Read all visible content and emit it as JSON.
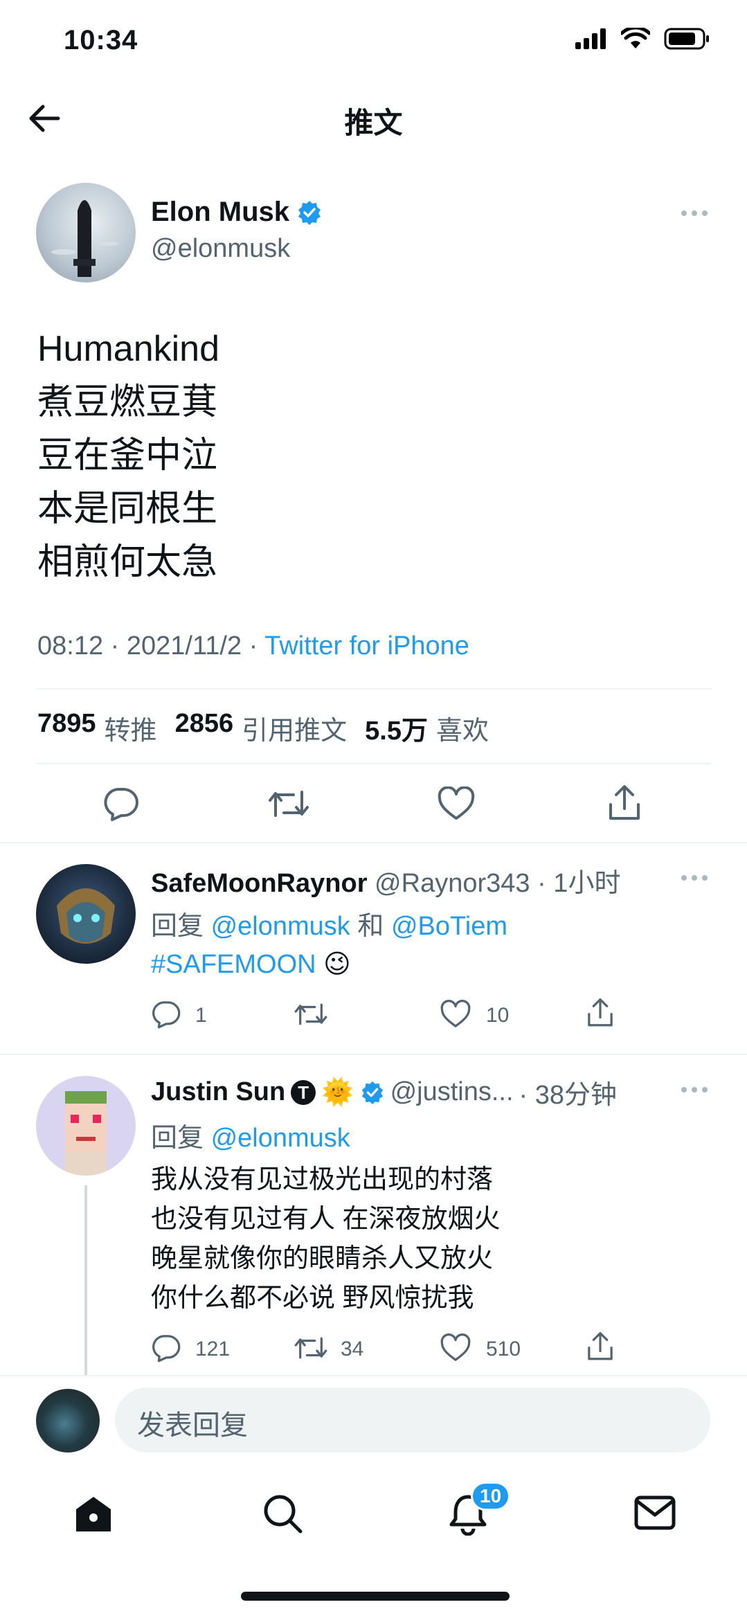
{
  "status_bar": {
    "time": "10:34"
  },
  "header": {
    "title": "推文"
  },
  "tweet": {
    "author_name": "Elon Musk",
    "author_handle": "@elonmusk",
    "lines": [
      "Humankind",
      "煮豆燃豆萁",
      "豆在釜中泣",
      "本是同根生",
      "相煎何太急"
    ],
    "time": "08:12",
    "date": "2021/11/2",
    "separator": "·",
    "source": "Twitter for iPhone",
    "stats": {
      "retweets": "7895",
      "retweets_label": "转推",
      "quotes": "2856",
      "quotes_label": "引用推文",
      "likes": "5.5万",
      "likes_label": "喜欢"
    }
  },
  "replies": [
    {
      "name": "SafeMoonRaynor",
      "handle": "@Raynor343",
      "time": "· 1小时",
      "reply_prefix": "回复",
      "reply_to_1": "@elonmusk",
      "reply_and": "和",
      "reply_to_2": "@BoTiem",
      "text": "#SAFEMOON",
      "emoji": "😉",
      "reply_count": "1",
      "retweet_count": "",
      "like_count": "10"
    },
    {
      "name": "Justin Sun",
      "name_badge": "T",
      "name_emoji": "🌞",
      "handle": "@justins...",
      "time": "· 38分钟",
      "reply_prefix": "回复",
      "reply_to_1": "@elonmusk",
      "lines": [
        "我从没有见过极光出现的村落",
        "也没有见过有人 在深夜放烟火",
        "晚星就像你的眼睛杀人又放火",
        "你什么都不必说 野风惊扰我"
      ],
      "reply_count": "121",
      "retweet_count": "34",
      "like_count": "510"
    }
  ],
  "compose": {
    "placeholder": "发表回复"
  },
  "tab_bar": {
    "notifications_badge": "10"
  },
  "colors": {
    "accent": "#1d9bf0",
    "muted": "#536471",
    "text": "#0f1419",
    "divider": "#eff3f4"
  },
  "icons": [
    "back-arrow-icon",
    "verified-icon",
    "more-icon",
    "reply-icon",
    "retweet-icon",
    "like-icon",
    "share-icon",
    "home-icon",
    "search-icon",
    "bell-icon",
    "mail-icon"
  ]
}
